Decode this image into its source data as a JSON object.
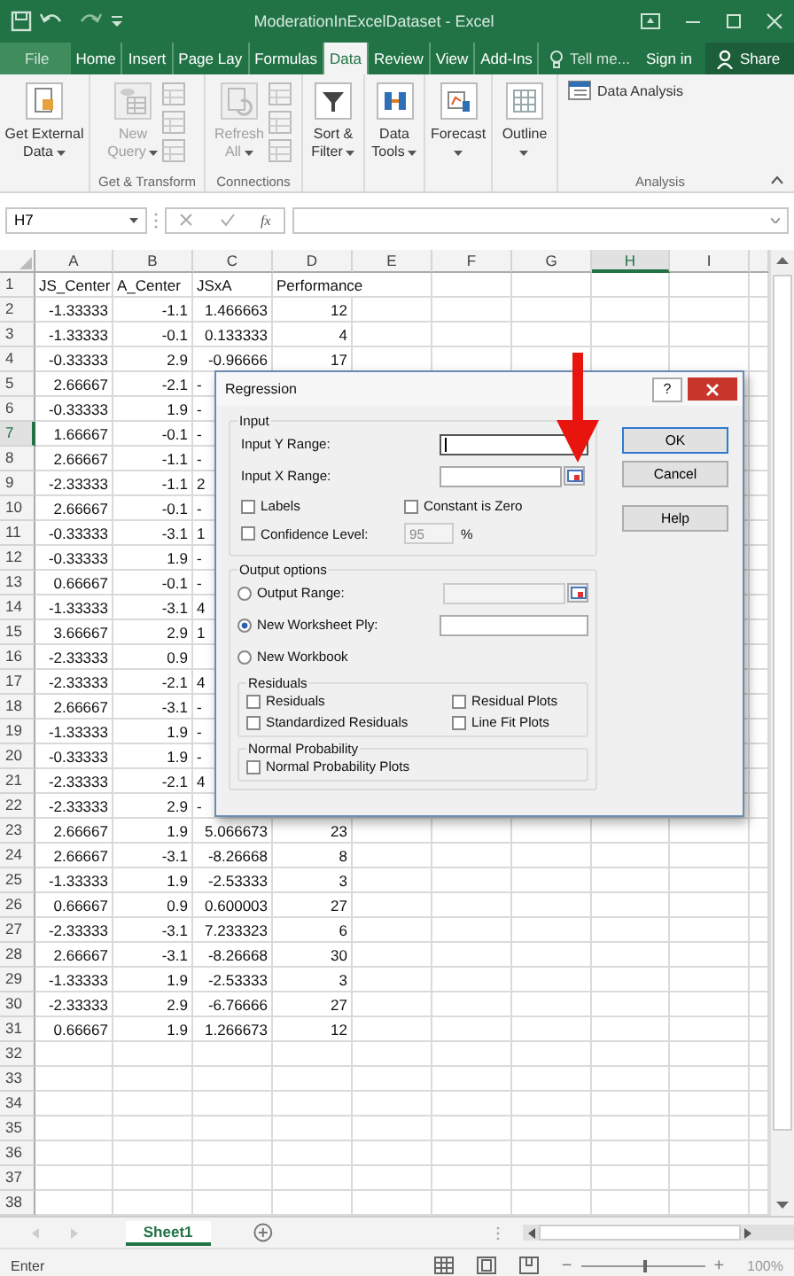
{
  "title_bar": {
    "title": "ModerationInExcelDataset - Excel"
  },
  "tabs": [
    {
      "label": "File",
      "selected": false
    },
    {
      "label": "Home",
      "selected": false
    },
    {
      "label": "Insert",
      "selected": false
    },
    {
      "label": "Page Lay",
      "selected": false
    },
    {
      "label": "Formulas",
      "selected": false
    },
    {
      "label": "Data",
      "selected": true
    },
    {
      "label": "Review",
      "selected": false
    },
    {
      "label": "View",
      "selected": false
    },
    {
      "label": "Add-Ins",
      "selected": false
    }
  ],
  "tell_me": "Tell me...",
  "sign_in": "Sign in",
  "share": "Share",
  "ribbon": {
    "groups": [
      {
        "items": [
          {
            "kind": "large",
            "lines": [
              "Get External",
              "Data"
            ],
            "dropdown": true,
            "disabled": false
          }
        ]
      },
      {
        "label": "Get & Transform",
        "items": [
          {
            "kind": "large",
            "lines": [
              "New",
              "Query"
            ],
            "dropdown": true,
            "disabled": true
          },
          {
            "kind": "small_stack",
            "disabled": true
          }
        ]
      },
      {
        "label": "Connections",
        "items": [
          {
            "kind": "large",
            "lines": [
              "Refresh",
              "All"
            ],
            "dropdown": true,
            "disabled": true
          },
          {
            "kind": "small_stack",
            "disabled": true
          }
        ]
      },
      {
        "items": [
          {
            "kind": "large",
            "lines": [
              "Sort &",
              "Filter"
            ],
            "dropdown": true,
            "disabled": false
          }
        ]
      },
      {
        "items": [
          {
            "kind": "large",
            "lines": [
              "Data",
              "Tools"
            ],
            "dropdown": true,
            "disabled": false
          }
        ]
      },
      {
        "items": [
          {
            "kind": "large",
            "lines": [
              "Forecast"
            ],
            "dropdown": true,
            "disabled": false
          }
        ]
      },
      {
        "items": [
          {
            "kind": "large",
            "lines": [
              "Outline"
            ],
            "dropdown": true,
            "disabled": false
          }
        ]
      },
      {
        "label": "Analysis",
        "items": [
          {
            "kind": "small",
            "lines": [
              "Data Analysis"
            ],
            "disabled": false
          }
        ]
      }
    ]
  },
  "formula_bar": {
    "name_box": "H7",
    "fx": "fx"
  },
  "columns": [
    {
      "label": "A",
      "selected": false
    },
    {
      "label": "B",
      "selected": false
    },
    {
      "label": "C",
      "selected": false
    },
    {
      "label": "D",
      "selected": false
    },
    {
      "label": "E",
      "selected": false
    },
    {
      "label": "F",
      "selected": false
    },
    {
      "label": "G",
      "selected": false
    },
    {
      "label": "H",
      "selected": true
    },
    {
      "label": "I",
      "selected": false
    }
  ],
  "rows": [
    {
      "row": "1",
      "kind": "header",
      "selected": false,
      "cells": [
        "JS_Center",
        "A_Center",
        "JSxA",
        "Performance"
      ]
    },
    {
      "row": "2",
      "kind": "data",
      "selected": false,
      "covered": false,
      "cells": [
        "-1.33333",
        "-1.1",
        "1.466663",
        "12"
      ]
    },
    {
      "row": "3",
      "kind": "data",
      "selected": false,
      "covered": false,
      "cells": [
        "-1.33333",
        "-0.1",
        "0.133333",
        "4"
      ]
    },
    {
      "row": "4",
      "kind": "data",
      "selected": false,
      "covered": false,
      "cells": [
        "-0.33333",
        "2.9",
        "-0.96666",
        "17"
      ]
    },
    {
      "row": "5",
      "kind": "data",
      "selected": false,
      "covered": true,
      "cells": [
        "2.66667",
        "-2.1",
        "-"
      ]
    },
    {
      "row": "6",
      "kind": "data",
      "selected": false,
      "covered": true,
      "cells": [
        "-0.33333",
        "1.9",
        "-"
      ]
    },
    {
      "row": "7",
      "kind": "data",
      "selected": true,
      "covered": true,
      "cells": [
        "1.66667",
        "-0.1",
        "-"
      ]
    },
    {
      "row": "8",
      "kind": "data",
      "selected": false,
      "covered": true,
      "cells": [
        "2.66667",
        "-1.1",
        "-"
      ]
    },
    {
      "row": "9",
      "kind": "data",
      "selected": false,
      "covered": true,
      "cells": [
        "-2.33333",
        "-1.1",
        "2"
      ]
    },
    {
      "row": "10",
      "kind": "data",
      "selected": false,
      "covered": true,
      "cells": [
        "2.66667",
        "-0.1",
        "-"
      ]
    },
    {
      "row": "11",
      "kind": "data",
      "selected": false,
      "covered": true,
      "cells": [
        "-0.33333",
        "-3.1",
        "1"
      ]
    },
    {
      "row": "12",
      "kind": "data",
      "selected": false,
      "covered": true,
      "cells": [
        "-0.33333",
        "1.9",
        "-"
      ]
    },
    {
      "row": "13",
      "kind": "data",
      "selected": false,
      "covered": true,
      "cells": [
        "0.66667",
        "-0.1",
        "-"
      ]
    },
    {
      "row": "14",
      "kind": "data",
      "selected": false,
      "covered": true,
      "cells": [
        "-1.33333",
        "-3.1",
        "4"
      ]
    },
    {
      "row": "15",
      "kind": "data",
      "selected": false,
      "covered": true,
      "cells": [
        "3.66667",
        "2.9",
        "1"
      ]
    },
    {
      "row": "16",
      "kind": "data",
      "selected": false,
      "cells": [
        "-2.33333",
        "0.9"
      ]
    },
    {
      "row": "17",
      "kind": "data",
      "selected": false,
      "covered": true,
      "cells": [
        "-2.33333",
        "-2.1",
        "4"
      ]
    },
    {
      "row": "18",
      "kind": "data",
      "selected": false,
      "covered": true,
      "cells": [
        "2.66667",
        "-3.1",
        "-"
      ]
    },
    {
      "row": "19",
      "kind": "data",
      "selected": false,
      "covered": true,
      "cells": [
        "-1.33333",
        "1.9",
        "-"
      ]
    },
    {
      "row": "20",
      "kind": "data",
      "selected": false,
      "covered": true,
      "cells": [
        "-0.33333",
        "1.9",
        "-"
      ]
    },
    {
      "row": "21",
      "kind": "data",
      "selected": false,
      "covered": true,
      "cells": [
        "-2.33333",
        "-2.1",
        "4"
      ]
    },
    {
      "row": "22",
      "kind": "data",
      "selected": false,
      "covered": true,
      "cells": [
        "-2.33333",
        "2.9",
        "-"
      ]
    },
    {
      "row": "23",
      "kind": "data",
      "selected": false,
      "covered": false,
      "cells": [
        "2.66667",
        "1.9",
        "5.066673",
        "23"
      ]
    },
    {
      "row": "24",
      "kind": "data",
      "selected": false,
      "covered": false,
      "cells": [
        "2.66667",
        "-3.1",
        "-8.26668",
        "8"
      ]
    },
    {
      "row": "25",
      "kind": "data",
      "selected": false,
      "covered": false,
      "cells": [
        "-1.33333",
        "1.9",
        "-2.53333",
        "3"
      ]
    },
    {
      "row": "26",
      "kind": "data",
      "selected": false,
      "covered": false,
      "cells": [
        "0.66667",
        "0.9",
        "0.600003",
        "27"
      ]
    },
    {
      "row": "27",
      "kind": "data",
      "selected": false,
      "covered": false,
      "cells": [
        "-2.33333",
        "-3.1",
        "7.233323",
        "6"
      ]
    },
    {
      "row": "28",
      "kind": "data",
      "selected": false,
      "covered": false,
      "cells": [
        "2.66667",
        "-3.1",
        "-8.26668",
        "30"
      ]
    },
    {
      "row": "29",
      "kind": "data",
      "selected": false,
      "covered": false,
      "cells": [
        "-1.33333",
        "1.9",
        "-2.53333",
        "3"
      ]
    },
    {
      "row": "30",
      "kind": "data",
      "selected": false,
      "covered": false,
      "cells": [
        "-2.33333",
        "2.9",
        "-6.76666",
        "27"
      ]
    },
    {
      "row": "31",
      "kind": "data",
      "selected": false,
      "covered": false,
      "cells": [
        "0.66667",
        "1.9",
        "1.266673",
        "12"
      ]
    },
    {
      "row": "32",
      "kind": "data",
      "selected": false,
      "cells": []
    },
    {
      "row": "33",
      "kind": "data",
      "selected": false,
      "cells": []
    },
    {
      "row": "34",
      "kind": "data",
      "selected": false,
      "cells": []
    },
    {
      "row": "35",
      "kind": "data",
      "selected": false,
      "cells": []
    },
    {
      "row": "36",
      "kind": "data",
      "selected": false,
      "cells": []
    },
    {
      "row": "37",
      "kind": "data",
      "selected": false,
      "cells": []
    },
    {
      "row": "38",
      "kind": "data",
      "selected": false,
      "cells": []
    }
  ],
  "sheets": [
    {
      "name": "Sheet1",
      "selected": true
    }
  ],
  "status_bar": {
    "status": "Enter",
    "zoom": {
      "minus": "−",
      "plus": "+",
      "level": 0.5,
      "percent": "100%"
    }
  },
  "dialog": {
    "title": "Regression",
    "help": "?",
    "input": {
      "legend": "Input",
      "fields": [
        {
          "label": "Input Y Range:",
          "focused": true,
          "picker": false
        },
        {
          "label": "Input X Range:",
          "focused": false,
          "picker": true
        }
      ],
      "checkboxes": [
        {
          "label": "Labels",
          "checked": false
        },
        {
          "label": "Constant is Zero",
          "checked": false
        },
        {
          "label": "Confidence Level:",
          "checked": false
        }
      ],
      "confidence": {
        "value": "95",
        "disabled": true,
        "unit": "%"
      }
    },
    "output": {
      "legend": "Output options",
      "radios": [
        {
          "label": "Output Range:",
          "selected": false,
          "field": {
            "disabled": true,
            "picker": true
          }
        },
        {
          "label": "New Worksheet Ply:",
          "selected": true,
          "field": {
            "disabled": false,
            "picker": false
          }
        },
        {
          "label": "New Workbook",
          "selected": false
        }
      ],
      "residuals": {
        "legend": "Residuals",
        "checkboxes": [
          {
            "label": "Residuals",
            "checked": false
          },
          {
            "label": "Residual Plots",
            "checked": false
          },
          {
            "label": "Standardized Residuals",
            "checked": false
          },
          {
            "label": "Line Fit Plots",
            "checked": false
          }
        ]
      },
      "normal": {
        "legend": "Normal Probability",
        "checkboxes": [
          {
            "label": "Normal Probability Plots",
            "checked": false
          }
        ]
      }
    },
    "buttons": [
      {
        "label": "OK",
        "default": true
      },
      {
        "label": "Cancel",
        "default": false
      },
      {
        "label": "Help",
        "default": false
      }
    ]
  }
}
